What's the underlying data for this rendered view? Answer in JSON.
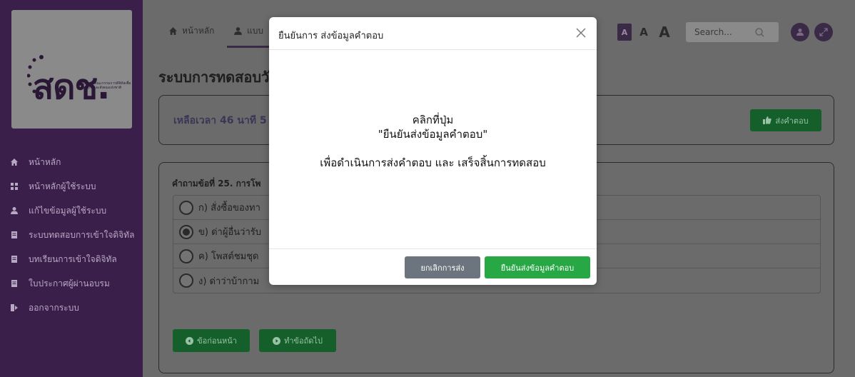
{
  "logo": {
    "text": "สดช.",
    "subtext": "สำนักงานคณะกรรมการดิจิทัลเพื่อเศรษฐกิจและสังคมแห่งชาติ"
  },
  "sidebar": {
    "items": [
      {
        "label": "หน้าหลัก",
        "icon": "home-icon"
      },
      {
        "label": "หน้าหลักผู้ใช้ระบบ",
        "icon": "grid-icon"
      },
      {
        "label": "แก้ไขข้อมูลผู้ใช้ระบบ",
        "icon": "user-icon"
      },
      {
        "label": "ระบบทดสอบการเข้าใจดิจิทัล",
        "icon": "document-icon"
      },
      {
        "label": "บทเรียนการเข้าใจดิจิทัล",
        "icon": "document-icon"
      },
      {
        "label": "ใบประกาศผู้ผ่านอบรม",
        "icon": "document-icon"
      },
      {
        "label": "ออกจากระบบ",
        "icon": "logout-icon"
      }
    ]
  },
  "topbar": {
    "home_label": "หน้าหลัก",
    "user_label": "แบบ",
    "font_small": "A",
    "font_medium": "A",
    "font_large": "A",
    "search_placeholder": "Search..."
  },
  "main": {
    "title": "ระบบการทดสอบวั",
    "timer_text": "เหลือเวลา 46 นาที 5",
    "submit_label": "ส่งคำตอบ",
    "question": "คำถามข้อที่ 25. การโพ",
    "options": [
      {
        "label": "ก) สั่งซื้อของทา",
        "selected": false
      },
      {
        "label": "ข) ด่าผู้อื่นว่ารับ",
        "selected": true
      },
      {
        "label": "ค) โพสต์ชมชุด",
        "selected": false
      },
      {
        "label": "ง) ด่าว่าบ้ากาม",
        "selected": false
      }
    ],
    "prev_label": "ข้อก่อนหน้า",
    "next_label": "ทำข้อถัดไป"
  },
  "modal": {
    "title": "ยืนยันการ ส่งข้อมูลคำตอบ",
    "line1": "คลิกที่ปุ่ม",
    "line2": "\"ยืนยันส่งข้อมูลคำตอบ\"",
    "line3": "เพื่อดำเนินการส่งคำตอบ และ เสร็จสิ้นการทดสอบ",
    "cancel_label": "ยกเลิกการส่ง",
    "confirm_label": "ยืนยันส่งข้อมูลคำตอบ"
  },
  "colors": {
    "sidebar_bg": "#3a1f4a",
    "overlay_bg": "#6b6b6b",
    "confirm_green": "#28a745",
    "cancel_gray": "#6c757d"
  }
}
